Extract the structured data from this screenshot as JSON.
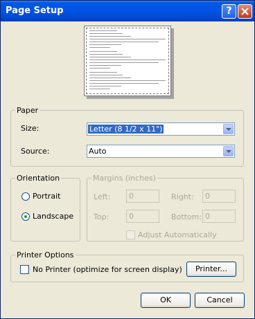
{
  "window": {
    "title": "Page Setup",
    "help_icon": "?"
  },
  "paper": {
    "legend": "Paper",
    "size_label": "Size:",
    "size_value": "Letter (8 1/2 x 11\")",
    "source_label": "Source:",
    "source_value": "Auto"
  },
  "orientation": {
    "legend": "Orientation",
    "portrait_label": "Portrait",
    "landscape_label": "Landscape",
    "selected": "Landscape"
  },
  "margins": {
    "legend": "Margins (inches)",
    "left_label": "Left:",
    "left_value": "0",
    "right_label": "Right:",
    "right_value": "0",
    "top_label": "Top:",
    "top_value": "0",
    "bottom_label": "Bottom:",
    "bottom_value": "0",
    "adjust_label": "Adjust Automatically"
  },
  "printer_options": {
    "legend": "Printer Options",
    "no_printer_label": "No Printer (optimize for screen display)",
    "printer_button": "Printer..."
  },
  "buttons": {
    "ok": "OK",
    "cancel": "Cancel"
  }
}
